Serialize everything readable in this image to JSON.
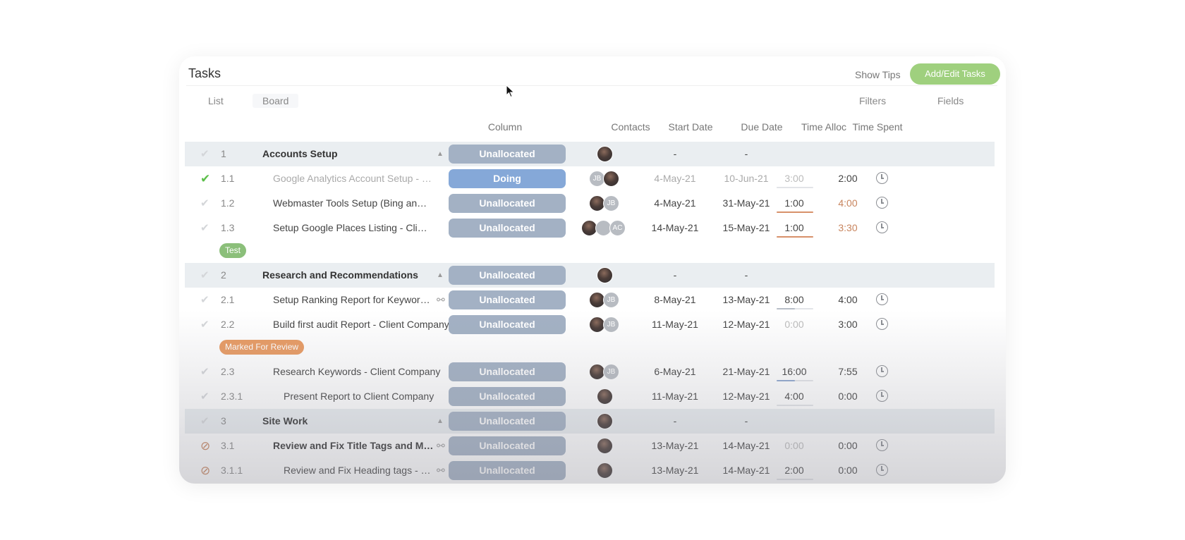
{
  "header": {
    "title": "Tasks",
    "show_tips": "Show Tips",
    "add_edit": "Add/Edit Tasks"
  },
  "tabs": {
    "list": "List",
    "board": "Board",
    "filters": "Filters",
    "fields": "Fields"
  },
  "columns": {
    "column": "Column",
    "contacts": "Contacts",
    "start": "Start Date",
    "due": "Due Date",
    "alloc": "Time Alloc",
    "spent": "Time Spent"
  },
  "rows": [
    {
      "num": "1",
      "name": "Accounts Setup",
      "column": "Unallocated",
      "start": "-",
      "due": "-",
      "alloc": "",
      "spent": ""
    },
    {
      "num": "1.1",
      "name": "Google Analytics Account Setup - Client...",
      "column": "Doing",
      "start": "4-May-21",
      "due": "10-Jun-21",
      "alloc": "3:00",
      "spent": "2:00",
      "alloc_fraction": 0.67
    },
    {
      "num": "1.2",
      "name": "Webmaster Tools Setup (Bing and Goo...",
      "column": "Unallocated",
      "start": "4-May-21",
      "due": "31-May-21",
      "alloc": "1:00",
      "spent": "4:00",
      "alloc_fraction": 1.0
    },
    {
      "num": "1.3",
      "name": "Setup Google Places Listing - Client Co...",
      "column": "Unallocated",
      "start": "14-May-21",
      "due": "15-May-21",
      "alloc": "1:00",
      "spent": "3:30",
      "alloc_fraction": 1.0
    },
    {
      "num": "2",
      "name": "Research and Recommendations",
      "column": "Unallocated",
      "start": "-",
      "due": "-",
      "alloc": "",
      "spent": ""
    },
    {
      "num": "2.1",
      "name": "Setup Ranking Report for Keywords...",
      "column": "Unallocated",
      "start": "8-May-21",
      "due": "13-May-21",
      "alloc": "8:00",
      "spent": "4:00",
      "alloc_fraction": 0.5
    },
    {
      "num": "2.2",
      "name": "Build first audit Report - Client Company",
      "column": "Unallocated",
      "start": "11-May-21",
      "due": "12-May-21",
      "alloc": "0:00",
      "spent": "3:00"
    },
    {
      "num": "2.3",
      "name": "Research Keywords - Client Company",
      "column": "Unallocated",
      "start": "6-May-21",
      "due": "21-May-21",
      "alloc": "16:00",
      "spent": "7:55",
      "alloc_fraction": 0.5
    },
    {
      "num": "2.3.1",
      "name": "Present Report to Client Company",
      "column": "Unallocated",
      "start": "11-May-21",
      "due": "12-May-21",
      "alloc": "4:00",
      "spent": "0:00",
      "alloc_fraction": 0.0
    },
    {
      "num": "3",
      "name": "Site Work",
      "column": "Unallocated",
      "start": "-",
      "due": "-",
      "alloc": "",
      "spent": ""
    },
    {
      "num": "3.1",
      "name": "Review and Fix Title Tags and Met...",
      "column": "Unallocated",
      "start": "13-May-21",
      "due": "14-May-21",
      "alloc": "0:00",
      "spent": "0:00"
    },
    {
      "num": "3.1.1",
      "name": "Review and Fix Heading tags - Cli...",
      "column": "Unallocated",
      "start": "13-May-21",
      "due": "14-May-21",
      "alloc": "2:00",
      "spent": "0:00",
      "alloc_fraction": 0.0
    }
  ],
  "contacts": {
    "jb": "JB",
    "ac": "AC"
  },
  "tags": {
    "test": "Test",
    "review": "Marked For Review"
  },
  "colors": {
    "accent_green": "#9fd07e",
    "doing_blue": "#85a8d8",
    "unallocated": "#a3b1c4",
    "over_budget": "#c8845d"
  },
  "icons": {
    "check": "checkmark-icon",
    "blocked": "blocked-icon",
    "link": "link-icon",
    "caret": "caret-up-icon",
    "clock": "clock-icon",
    "cursor": "mouse-cursor-icon"
  }
}
